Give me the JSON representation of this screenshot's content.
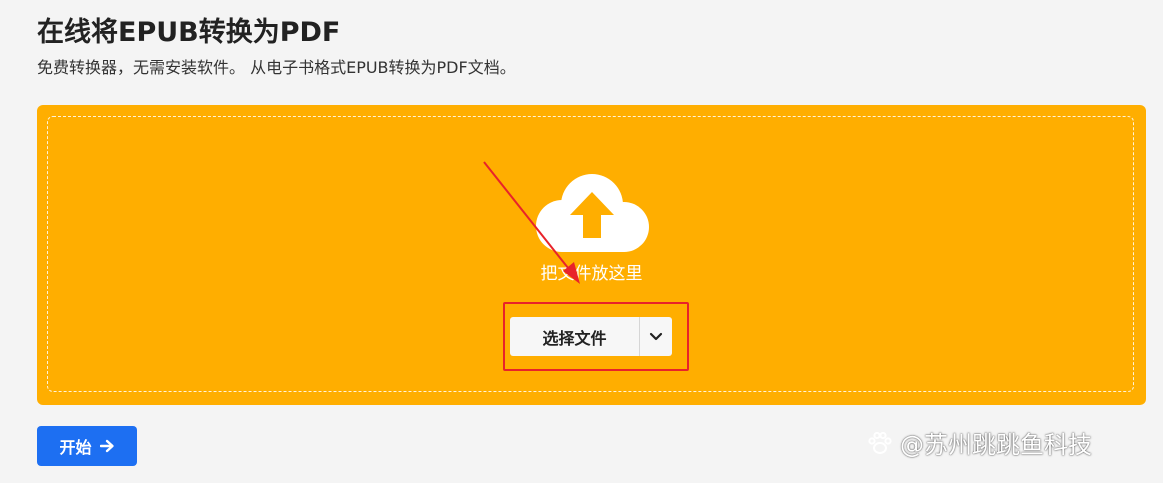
{
  "header": {
    "title": "在线将EPUB转换为PDF",
    "subtitle": "免费转换器，无需安装软件。 从电子书格式EPUB转换为PDF文档。"
  },
  "upload": {
    "drop_text": "把文件放这里",
    "select_label": "选择文件",
    "cloud_icon": "cloud-upload-icon",
    "dropdown_icon": "chevron-down-icon",
    "panel_color": "#ffae00"
  },
  "actions": {
    "start_label": "开始",
    "start_icon": "arrow-right-icon",
    "start_color": "#1d6ff2"
  },
  "annotation": {
    "highlight_color": "#e8232a"
  },
  "watermark": {
    "icon": "paw-icon",
    "text": "@苏州跳跳鱼科技"
  }
}
